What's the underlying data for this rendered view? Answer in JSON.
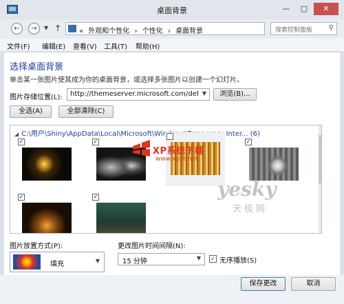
{
  "window": {
    "title": "桌面背景",
    "buttons": {
      "minimize": "—",
      "maximize": "▢",
      "close": "✕"
    }
  },
  "nav": {
    "breadcrumb": [
      "«",
      "外观和个性化",
      "›",
      "个性化",
      "›",
      "桌面背景"
    ],
    "search_placeholder": "搜索控制面板"
  },
  "menu": [
    "文件(F)",
    "编辑(E)",
    "查看(V)",
    "工具(T)",
    "帮助(H)"
  ],
  "content": {
    "heading": "选择桌面背景",
    "description": "单击某一张图片使其成为你的桌面背景，或选择多张图片以创建一个幻灯片。",
    "location_label": "图片存储位置(L):",
    "location_value": "http://themeserver.microsoft.com/defa",
    "browse_label": "浏览(B)...",
    "select_all_label": "全选(A)",
    "clear_all_label": "全部清除(C)",
    "group_header": "C:\\用户\\Shiny\\AppData\\Local\\Microsoft\\Windows\\Temporary Inter...  (6)",
    "thumbnails": [
      {
        "checked": "✓"
      },
      {
        "checked": "✓"
      },
      {
        "checked": ""
      },
      {
        "checked": "✓"
      },
      {
        "checked": "✓"
      },
      {
        "checked": "✓"
      }
    ]
  },
  "bottom": {
    "position_label": "图片放置方式(P):",
    "position_value": "填充",
    "interval_label": "更改图片时间间隔(N):",
    "interval_value": "15 分钟",
    "shuffle_checked": "✓",
    "shuffle_label": "无序播放(S)"
  },
  "footer": {
    "save_label": "保存更改",
    "cancel_label": "取消"
  },
  "watermarks": {
    "xp_brand": "XP系统下载",
    "xp_url": "www.xpxt.net",
    "yesky": "yesky",
    "yesky_cn": "天极网"
  }
}
